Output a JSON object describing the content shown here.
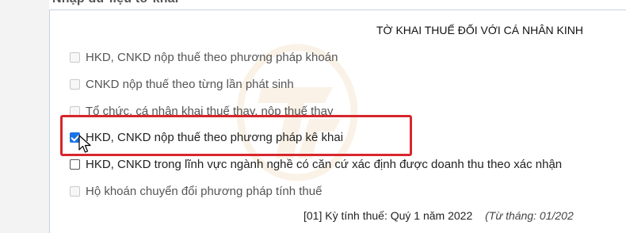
{
  "section_title": "Nhập dữ liệu tờ khai",
  "form_title": "TỜ KHAI THUẾ ĐỐI VỚI CÁ NHÂN KINH",
  "options": [
    {
      "label": "HKD, CNKD nộp thuế theo phương pháp khoán",
      "checked": false,
      "enabled": false
    },
    {
      "label": "CNKD nộp thuế theo từng lần phát sinh",
      "checked": false,
      "enabled": false
    },
    {
      "label": "Tổ chức, cá nhân khai thuế thay, nộp thuế thay",
      "checked": false,
      "enabled": false
    },
    {
      "label": "HKD, CNKD nộp thuế theo phương pháp kê khai",
      "checked": true,
      "enabled": true
    },
    {
      "label": "HKD, CNKD trong lĩnh vực ngành nghề có căn cứ xác định được doanh thu theo xác nhận",
      "checked": false,
      "enabled": true
    },
    {
      "label": "Hộ khoán chuyển đổi phương pháp tính thuế",
      "checked": false,
      "enabled": false
    }
  ],
  "period": {
    "label": "[01] Kỳ tính thuế: Quý 1 năm 2022",
    "from": "(Từ tháng: 01/202"
  },
  "colors": {
    "highlight": "#d7262c",
    "checkbox_checked": "#1a73e8",
    "frame_border": "#c6d3e3",
    "watermark": "#e0a050"
  },
  "icons": {
    "watermark": "logo-watermark",
    "cursor": "mouse-pointer-icon"
  }
}
